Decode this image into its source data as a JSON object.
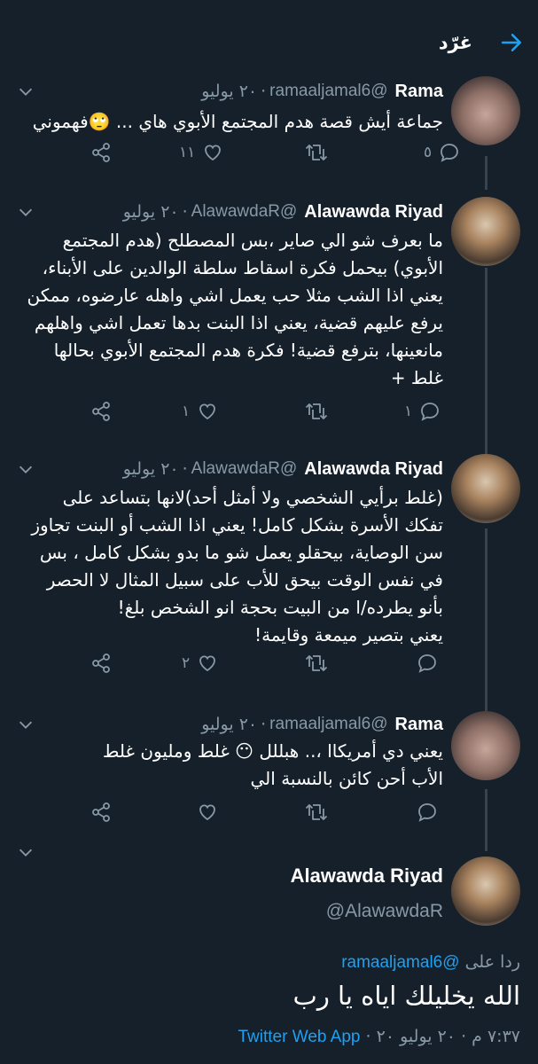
{
  "header": {
    "title": "غرّد"
  },
  "tweets": [
    {
      "name": "Rama",
      "handle": "@ramaaljamal6",
      "date": "٢٠ يوليو",
      "lines": [
        "جماعة أيش قصة هدم المجتمع الأبوي هاي ... 🙄فهموني"
      ],
      "replies": "٥",
      "retweets": "",
      "likes": "١١"
    },
    {
      "name": "Alawawda Riyad",
      "handle": "@AlawawdaR",
      "date": "٢٠ يوليو",
      "lines": [
        "ما بعرف شو الي صاير ،بس المصطلح (هدم المجتمع",
        "الأبوي) بيحمل فكرة اسقاط سلطة الوالدين على الأبناء،",
        "يعني اذا الشب مثلا حب يعمل اشي واهله عارضوه، ممكن",
        "يرفع عليهم قضية، يعني اذا البنت بدها تعمل اشي واهلهم",
        "مانعينها، بترفع قضية! فكرة هدم المجتمع الأبوي بحالها",
        "غلط +"
      ],
      "replies": "١",
      "retweets": "",
      "likes": "١"
    },
    {
      "name": "Alawawda Riyad",
      "handle": "@AlawawdaR",
      "date": "٢٠ يوليو",
      "lines": [
        "(غلط برأيي الشخصي ولا أمثل أحد)لانها بتساعد على",
        "تفكك الأسرة بشكل كامل! يعني اذا الشب أو البنت تجاوز",
        "سن الوصاية، بيحقلو يعمل شو ما بدو بشكل كامل ، بس",
        "في نفس الوقت بيحق للأب على سبيل المثال لا الحصر",
        "بأنو يطرده/ا من البيت بحجة انو الشخص بلغ!",
        "يعني بتصير ميمعة وقايمة!"
      ],
      "replies": "",
      "retweets": "",
      "likes": "٢"
    },
    {
      "name": "Rama",
      "handle": "@ramaaljamal6",
      "date": "٢٠ يوليو",
      "lines": [
        "يعني دي أمريكاا ،.. هبللل 😶 غلط ومليون غلط",
        "الأب أحن كائن بالنسبة الي"
      ],
      "replies": "",
      "retweets": "",
      "likes": ""
    }
  ],
  "main_tweet": {
    "name": "Alawawda Riyad",
    "handle": "@AlawawdaR",
    "reply_prefix": "ردا على",
    "reply_mention": "@ramaaljamal6",
    "text": "الله يخليلك اياه يا رب",
    "time": "٧:٣٧ م",
    "date": "٢٠ يوليو ٢٠",
    "app": "Twitter Web App"
  },
  "colors": {
    "background": "#15202b",
    "secondary_text": "#8899a6",
    "accent": "#1da1f2",
    "thread_line": "#38444d"
  }
}
